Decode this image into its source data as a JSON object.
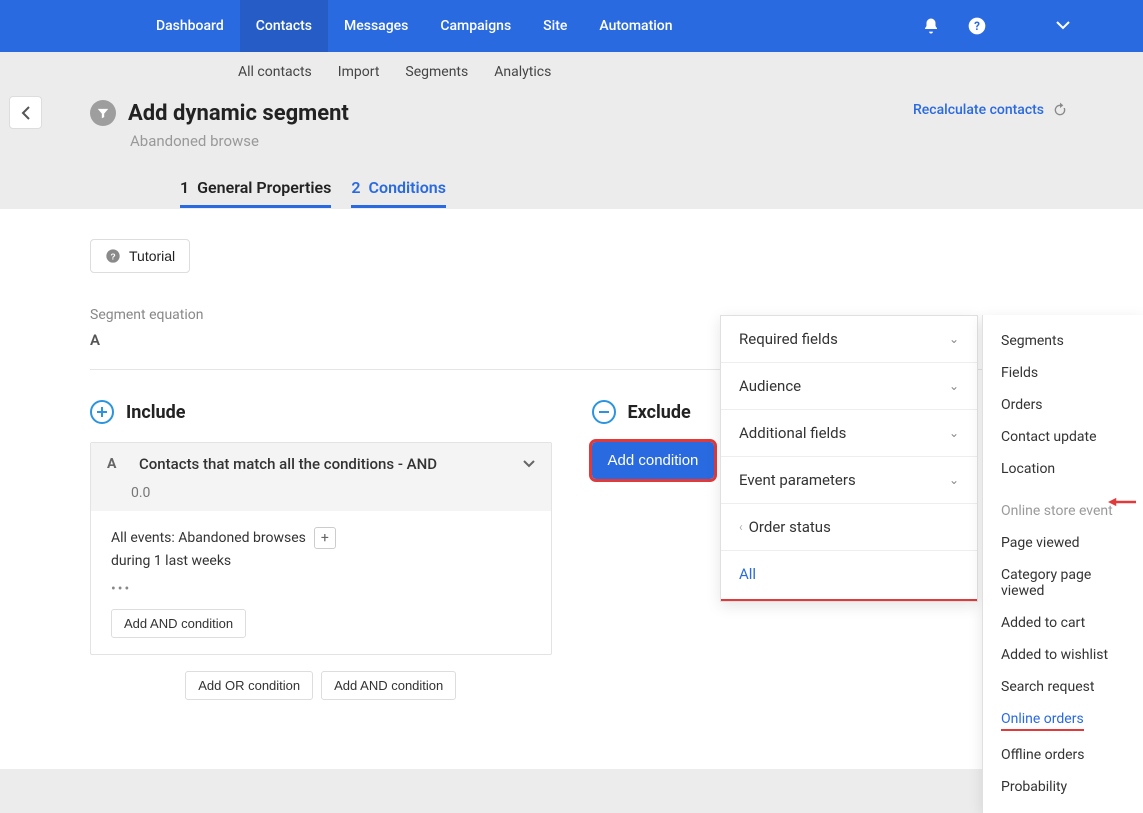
{
  "topnav": {
    "items": [
      "Dashboard",
      "Contacts",
      "Messages",
      "Campaigns",
      "Site",
      "Automation"
    ],
    "active": "Contacts"
  },
  "subnav": {
    "items": [
      "All contacts",
      "Import",
      "Segments",
      "Analytics"
    ]
  },
  "page": {
    "title": "Add dynamic segment",
    "subtitle": "Abandoned browse",
    "recalculate": "Recalculate contacts"
  },
  "steps": [
    {
      "num": "1",
      "label": "General Properties"
    },
    {
      "num": "2",
      "label": "Conditions"
    }
  ],
  "tutorial": "Tutorial",
  "equationLabel": "Segment equation",
  "equationValue": "A",
  "include": {
    "title": "Include"
  },
  "exclude": {
    "title": "Exclude"
  },
  "cardA": {
    "letter": "A",
    "title": "Contacts that match all the conditions - AND",
    "score": "0.0",
    "eventLine1": "All events: Abandoned browses",
    "eventLine2": "during 1 last weeks",
    "addAnd": "Add AND condition"
  },
  "footer": {
    "addOr": "Add OR condition",
    "addAnd": "Add AND condition"
  },
  "addConditionBtn": "Add condition",
  "popover1": {
    "requiredFields": "Required fields",
    "audience": "Audience",
    "additionalFields": "Additional fields",
    "eventParameters": "Event parameters",
    "orderStatus": "Order status",
    "all": "All"
  },
  "popover2": {
    "segments": "Segments",
    "fields": "Fields",
    "orders": "Orders",
    "contactUpdate": "Contact update",
    "location": "Location",
    "header": "Online store event",
    "pageViewed": "Page viewed",
    "categoryPageViewed": "Category page viewed",
    "addedToCart": "Added to cart",
    "addedToWishlist": "Added to wishlist",
    "searchRequest": "Search request",
    "onlineOrders": "Online orders",
    "offlineOrders": "Offline orders",
    "probability": "Probability"
  }
}
